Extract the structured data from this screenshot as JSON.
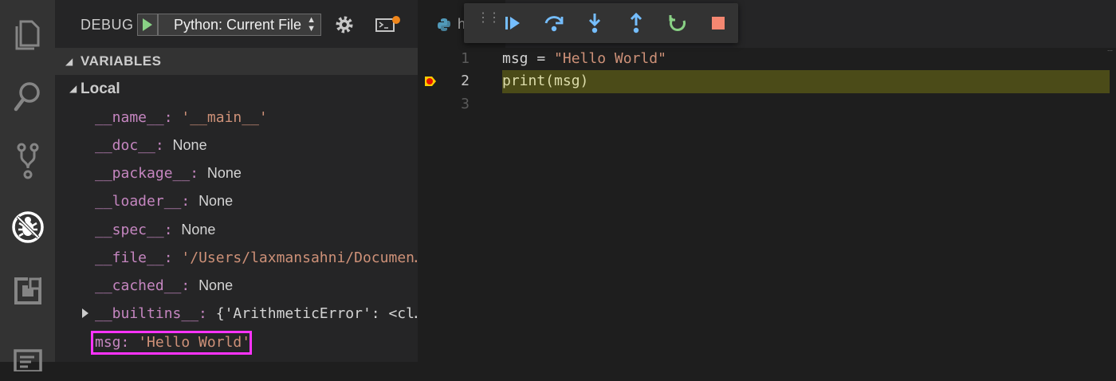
{
  "sidebar": {
    "debug_label": "DEBUG",
    "config_select": "Python: Current File",
    "variables_header": "VARIABLES",
    "scope_label": "Local",
    "variables": [
      {
        "name": "__name__",
        "sep": ": ",
        "value": "'__main__'",
        "kind": "str"
      },
      {
        "name": "__doc__",
        "sep": ": ",
        "value": "None",
        "kind": "plain"
      },
      {
        "name": "__package__",
        "sep": ": ",
        "value": "None",
        "kind": "plain"
      },
      {
        "name": "__loader__",
        "sep": ": ",
        "value": "None",
        "kind": "plain"
      },
      {
        "name": "__spec__",
        "sep": ": ",
        "value": "None",
        "kind": "plain"
      },
      {
        "name": "__file__",
        "sep": ": ",
        "value": "'/Users/laxmansahni/Documen…",
        "kind": "str"
      },
      {
        "name": "__cached__",
        "sep": ": ",
        "value": "None",
        "kind": "plain"
      },
      {
        "name": "__builtins__",
        "sep": ": ",
        "value": "{'ArithmeticError': <cl…",
        "kind": "obj"
      },
      {
        "name": "msg",
        "sep": ": ",
        "value": "'Hello World'",
        "kind": "str"
      }
    ]
  },
  "editor": {
    "tab_label": "h",
    "line_numbers": [
      "1",
      "2",
      "3"
    ],
    "code": {
      "line1_var": "msg",
      "line1_op": " = ",
      "line1_str": "\"Hello World\"",
      "line2": "print(msg)",
      "line3": ""
    }
  },
  "colors": {
    "accent_highlight": "#ff33ff",
    "current_line": "#4b4b18",
    "continue": "#75beff",
    "restart": "#89d185",
    "stop": "#f48771"
  },
  "icons": {
    "activity": [
      "files-icon",
      "search-icon",
      "source-control-icon",
      "debug-icon",
      "extensions-icon",
      "outline-icon"
    ],
    "debug_toolbar": [
      "continue-icon",
      "step-over-icon",
      "step-into-icon",
      "step-out-icon",
      "restart-icon",
      "stop-icon"
    ]
  }
}
